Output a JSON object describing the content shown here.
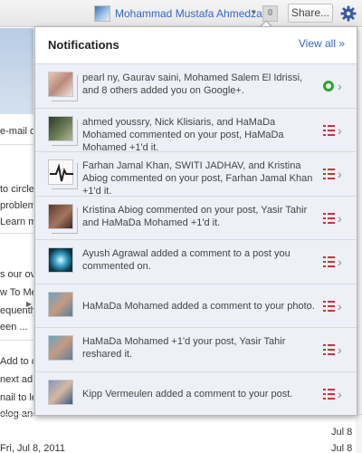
{
  "topbar": {
    "username": "Mohammad Mustafa Ahmedzai",
    "notification_count": "0",
    "share_label": "Share..."
  },
  "background": {
    "snippets": [
      "e-mail o",
      "to circle",
      "problem",
      "Learn m",
      "s our ov",
      "w To Me",
      "equently",
      "een ...",
      "Add to c",
      "next ad",
      "nail to le",
      "olog and"
    ],
    "dates": [
      "Jul 8",
      "Jul 8"
    ],
    "bottom_row": "Fri, Jul 8, 2011"
  },
  "notifications": {
    "title": "Notifications",
    "view_all": "View all »",
    "items": [
      {
        "text": "pearl ny, Gaurav saini, Mohamed Salem El Idrissi, and 8 others added you on Google+.",
        "action": "circle"
      },
      {
        "text": "ahmed youssry, Nick Klisiaris, and HaMaDa Mohamed commented on your post, HaMaDa Mohamed +1'd it.",
        "action": "list"
      },
      {
        "text": "Farhan Jamal Khan, SWITI JADHAV, and Kristina Abiog commented on your post, Farhan Jamal Khan +1'd it.",
        "action": "list"
      },
      {
        "text": "Kristina Abiog commented on your post, Yasir Tahir and HaMaDa Mohamed +1'd it.",
        "action": "list"
      },
      {
        "text": "Ayush Agrawal added a comment to a post you commented on.",
        "action": "list"
      },
      {
        "text": "HaMaDa Mohamed added a comment to your photo.",
        "action": "list"
      },
      {
        "text": "HaMaDa Mohamed +1'd your post, Yasir Tahir reshared it.",
        "action": "list"
      },
      {
        "text": "Kipp Vermeulen added a comment to your post.",
        "action": "list"
      }
    ]
  },
  "colors": {
    "link": "#3366cc",
    "item_bg": "#eef0f8",
    "circle_green": "#2fa32f",
    "list_red": "#cc3333"
  }
}
